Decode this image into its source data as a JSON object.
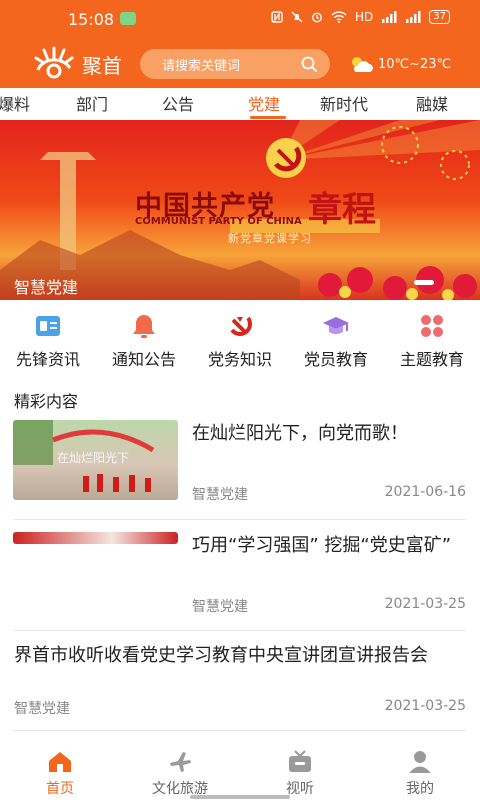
{
  "status_bar": {
    "time": "15:08",
    "network": "HD",
    "battery": "37",
    "app_icon": "chat-icon"
  },
  "header": {
    "logo_text": "聚首",
    "search_placeholder": "请搜索关键词",
    "weather": {
      "icon": "partly-cloudy-icon",
      "temp": "10℃~23℃"
    }
  },
  "tabs": [
    {
      "label": "爆料",
      "active": false
    },
    {
      "label": "部门",
      "active": false
    },
    {
      "label": "公告",
      "active": false
    },
    {
      "label": "党建",
      "active": true
    },
    {
      "label": "新时代",
      "active": false
    },
    {
      "label": "融媒",
      "active": false
    }
  ],
  "banner": {
    "title": "中国共产党",
    "title_big": "章程",
    "title_en": "COMMUNIST PARTY OF CHINA",
    "subtitle": "新党章党课学习",
    "caption": "智慧党建"
  },
  "quick_menu": [
    {
      "label": "先锋资讯",
      "icon": "news-card-icon",
      "color": "#4aa3e8"
    },
    {
      "label": "通知公告",
      "icon": "bell-icon",
      "color": "#f26a4a"
    },
    {
      "label": "党务知识",
      "icon": "party-emblem-icon",
      "color": "#d9261c"
    },
    {
      "label": "党员教育",
      "icon": "graduation-cap-icon",
      "color": "#9b6be0"
    },
    {
      "label": "主题教育",
      "icon": "clover-icon",
      "color": "#ef6a6a"
    }
  ],
  "section": {
    "title": "精彩内容"
  },
  "news": [
    {
      "title": "在灿烂阳光下，向党而歌！",
      "source": "智慧党建",
      "date": "2021-06-16"
    },
    {
      "title": "巧用“学习强国” 挖掘“党史富矿”",
      "source": "智慧党建",
      "date": "2021-03-25"
    },
    {
      "title": "界首市收听收看党史学习教育中央宣讲团宣讲报告会",
      "source": "智慧党建",
      "date": "2021-03-25"
    }
  ],
  "bottom_nav": [
    {
      "label": "首页",
      "icon": "home-icon",
      "active": true
    },
    {
      "label": "文化旅游",
      "icon": "airplane-icon",
      "active": false
    },
    {
      "label": "视听",
      "icon": "tv-icon",
      "active": false
    },
    {
      "label": "我的",
      "icon": "user-icon",
      "active": false
    }
  ],
  "colors": {
    "accent": "#f4651d",
    "text": "#222222",
    "muted": "#888888"
  }
}
